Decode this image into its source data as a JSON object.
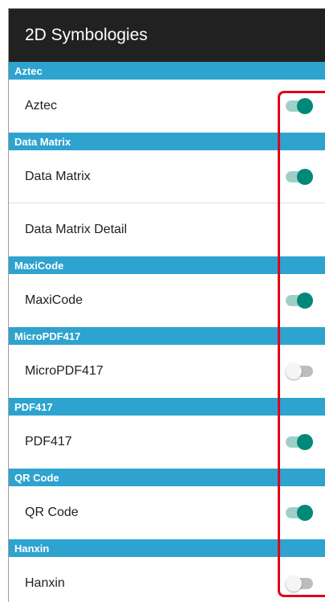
{
  "appbar": {
    "title": "2D Symbologies"
  },
  "sections": [
    {
      "header": "Aztec",
      "rows": [
        {
          "label": "Aztec",
          "toggle": "on"
        }
      ]
    },
    {
      "header": "Data Matrix",
      "rows": [
        {
          "label": "Data Matrix",
          "toggle": "on"
        },
        {
          "label": "Data Matrix Detail",
          "toggle": "none"
        }
      ]
    },
    {
      "header": "MaxiCode",
      "rows": [
        {
          "label": "MaxiCode",
          "toggle": "on"
        }
      ]
    },
    {
      "header": "MicroPDF417",
      "rows": [
        {
          "label": "MicroPDF417",
          "toggle": "off"
        }
      ]
    },
    {
      "header": "PDF417",
      "rows": [
        {
          "label": "PDF417",
          "toggle": "on"
        }
      ]
    },
    {
      "header": "QR Code",
      "rows": [
        {
          "label": "QR Code",
          "toggle": "on"
        }
      ]
    },
    {
      "header": "Hanxin",
      "rows": [
        {
          "label": "Hanxin",
          "toggle": "off"
        }
      ]
    }
  ],
  "colors": {
    "appbar": "#212121",
    "section_header": "#2ea3cf",
    "switch_on": "#00897b",
    "highlight": "#e0001a"
  }
}
